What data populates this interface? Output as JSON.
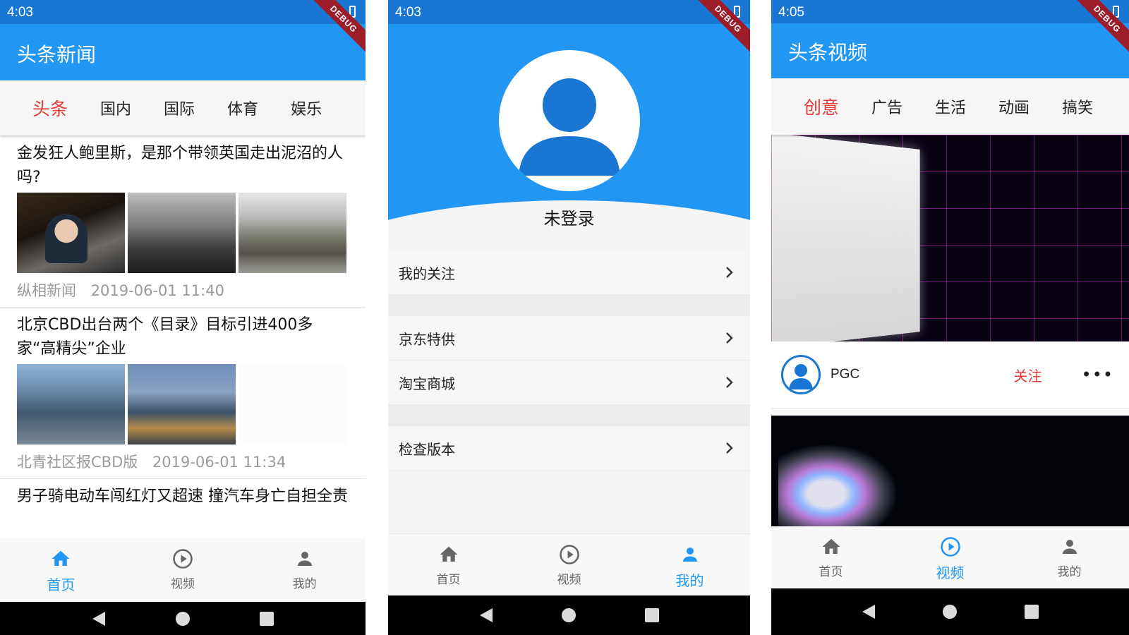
{
  "colors": {
    "primary": "#2196f3",
    "status_bar": "#1976d2",
    "accent_red": "#e53935",
    "debug_banner": "#9c1c2a"
  },
  "phone1": {
    "time": "4:03",
    "debug": "DEBUG",
    "title": "头条新闻",
    "tabs": [
      "头条",
      "国内",
      "国际",
      "体育",
      "娱乐"
    ],
    "active_tab": "头条",
    "articles": [
      {
        "title": "金发狂人鲍里斯，是那个带领英国走出泥沼的人吗?",
        "source": "纵相新闻",
        "time": "2019-06-01 11:40"
      },
      {
        "title": "北京CBD出台两个《目录》目标引进400多家“高精尖”企业",
        "source": "北青社区报CBD版",
        "time": "2019-06-01 11:34"
      },
      {
        "title": "男子骑电动车闯红灯又超速 撞汽车身亡自担全责"
      }
    ],
    "nav": [
      {
        "label": "首页",
        "icon": "home-icon",
        "active": true
      },
      {
        "label": "视频",
        "icon": "play-circle-icon",
        "active": false
      },
      {
        "label": "我的",
        "icon": "person-icon",
        "active": false
      }
    ]
  },
  "phone2": {
    "time": "4:03",
    "debug": "DEBUG",
    "login_status": "未登录",
    "menu": [
      "我的关注",
      "京东特供",
      "淘宝商城",
      "检查版本"
    ],
    "nav": [
      {
        "label": "首页",
        "icon": "home-icon",
        "active": false
      },
      {
        "label": "视频",
        "icon": "play-circle-icon",
        "active": false
      },
      {
        "label": "我的",
        "icon": "person-icon",
        "active": true
      }
    ]
  },
  "phone3": {
    "time": "4:05",
    "debug": "DEBUG",
    "title": "头条视频",
    "tabs": [
      "创意",
      "广告",
      "生活",
      "动画",
      "搞笑"
    ],
    "active_tab": "创意",
    "author": "PGC",
    "follow": "关注",
    "more": "•••",
    "nav": [
      {
        "label": "首页",
        "icon": "home-icon",
        "active": false
      },
      {
        "label": "视频",
        "icon": "play-circle-icon",
        "active": true
      },
      {
        "label": "我的",
        "icon": "person-icon",
        "active": false
      }
    ]
  }
}
